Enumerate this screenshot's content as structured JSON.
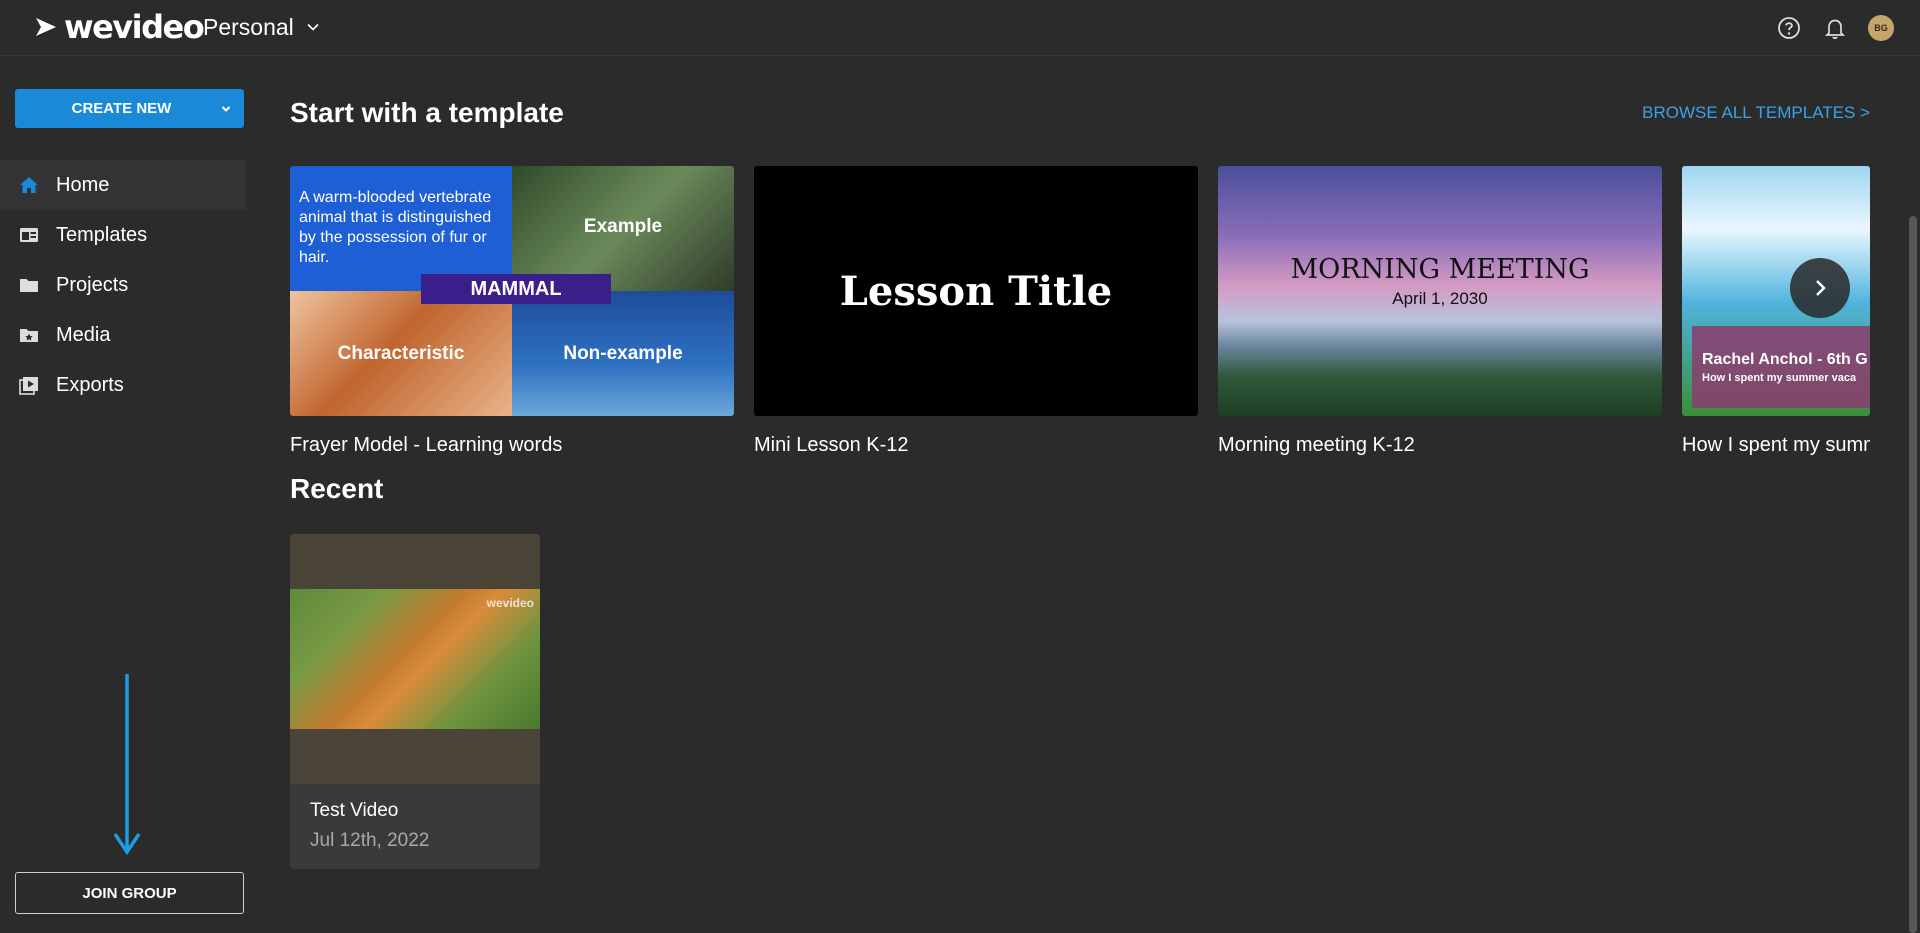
{
  "header": {
    "logo_text": "wevideo",
    "account": "Personal",
    "avatar_initials": "BG"
  },
  "sidebar": {
    "create_label": "CREATE NEW",
    "items": [
      {
        "label": "Home",
        "icon": "home-icon"
      },
      {
        "label": "Templates",
        "icon": "templates-icon"
      },
      {
        "label": "Projects",
        "icon": "folder-icon"
      },
      {
        "label": "Media",
        "icon": "media-folder-icon"
      },
      {
        "label": "Exports",
        "icon": "exports-icon"
      }
    ],
    "join_label": "JOIN GROUP"
  },
  "main": {
    "templates_title": "Start with a template",
    "browse_label": "BROWSE ALL TEMPLATES >",
    "templates": [
      {
        "label": "Frayer Model - Learning words",
        "definition": "A warm-blooded vertebrate animal that is distinguished by the possession of fur or hair.",
        "word": "MAMMAL",
        "quadrants": [
          "Example",
          "Characteristic",
          "Non-example"
        ]
      },
      {
        "label": "Mini Lesson K-12",
        "title": "Lesson Title"
      },
      {
        "label": "Morning meeting K-12",
        "title": "MORNING MEETING",
        "date": "April 1, 2030"
      },
      {
        "label": "How I spent my summ",
        "name": "Rachel Anchol - 6th G",
        "subtitle": "How I spent my summer vaca"
      }
    ],
    "recent_title": "Recent",
    "recent": [
      {
        "title": "Test Video",
        "date": "Jul 12th, 2022",
        "watermark": "wevideo"
      }
    ]
  },
  "colors": {
    "background": "#2b2b2b",
    "accent": "#1a8ad8",
    "link": "#3aa3e6"
  }
}
